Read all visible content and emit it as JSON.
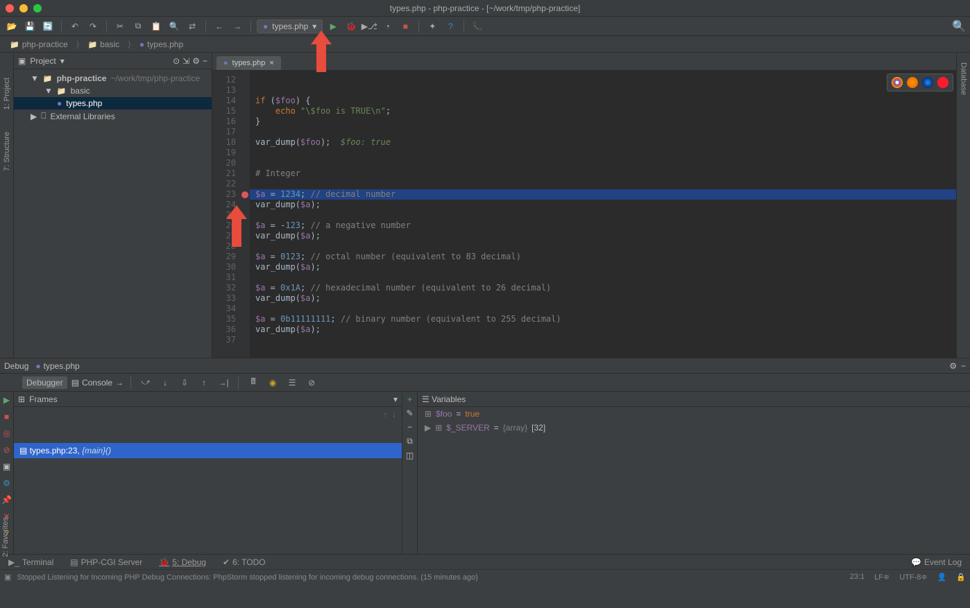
{
  "title": "types.php - php-practice - [~/work/tmp/php-practice]",
  "runConfig": {
    "label": "types.php"
  },
  "breadcrumb": {
    "root": "php-practice",
    "folder": "basic",
    "file": "types.php"
  },
  "projectPanel": {
    "title": "Project"
  },
  "tree": {
    "root": "php-practice",
    "rootPath": "~/work/tmp/php-practice",
    "folder": "basic",
    "file": "types.php",
    "external": "External Libraries"
  },
  "editorTab": {
    "label": "types.php"
  },
  "code": {
    "startLine": 12,
    "lines": [
      {
        "n": 12,
        "html": ""
      },
      {
        "n": 13,
        "html": ""
      },
      {
        "n": 14,
        "html": "<span class='kw'>if</span> (<span class='var'>$foo</span>) {"
      },
      {
        "n": 15,
        "html": "    <span class='kw'>echo</span> <span class='str'>\"\\$foo is TRUE\\n\"</span>;"
      },
      {
        "n": 16,
        "html": "}"
      },
      {
        "n": 17,
        "html": ""
      },
      {
        "n": 18,
        "html": "var_dump(<span class='var'>$foo</span>);  <span class='inl'>$foo: true</span>"
      },
      {
        "n": 19,
        "html": ""
      },
      {
        "n": 20,
        "html": ""
      },
      {
        "n": 21,
        "html": "<span class='com'># Integer</span>"
      },
      {
        "n": 22,
        "html": ""
      },
      {
        "n": 23,
        "html": "<span class='var'>$a</span> = <span class='num'>1234</span>; <span class='com'>// decimal number</span>",
        "hl": true,
        "bp": true
      },
      {
        "n": 24,
        "html": "var_dump(<span class='var'>$a</span>);"
      },
      {
        "n": 25,
        "html": ""
      },
      {
        "n": 26,
        "html": "<span class='var'>$a</span> = -<span class='num'>123</span>; <span class='com'>// a negative number</span>"
      },
      {
        "n": 27,
        "html": "var_dump(<span class='var'>$a</span>);"
      },
      {
        "n": 28,
        "html": ""
      },
      {
        "n": 29,
        "html": "<span class='var'>$a</span> = <span class='num'>0123</span>; <span class='com'>// octal number (equivalent to 83 decimal)</span>"
      },
      {
        "n": 30,
        "html": "var_dump(<span class='var'>$a</span>);"
      },
      {
        "n": 31,
        "html": ""
      },
      {
        "n": 32,
        "html": "<span class='var'>$a</span> = <span class='num'>0x1A</span>; <span class='com'>// hexadecimal number (equivalent to 26 decimal)</span>"
      },
      {
        "n": 33,
        "html": "var_dump(<span class='var'>$a</span>);"
      },
      {
        "n": 34,
        "html": ""
      },
      {
        "n": 35,
        "html": "<span class='var'>$a</span> = <span class='num'>0b11111111</span>; <span class='com'>// binary number (equivalent to 255 decimal)</span>"
      },
      {
        "n": 36,
        "html": "var_dump(<span class='var'>$a</span>);"
      },
      {
        "n": 37,
        "html": ""
      }
    ]
  },
  "leftTabs": {
    "project": "1: Project",
    "structure": "7: Structure",
    "favorites": "2: Favorites"
  },
  "rightTabs": {
    "database": "Database"
  },
  "debug": {
    "tabLabel": "Debug",
    "fileTab": "types.php",
    "subTabs": {
      "debugger": "Debugger",
      "console": "Console"
    },
    "framesTitle": "Frames",
    "frameItem": {
      "file": "types.php:23,",
      "fn": "{main}()"
    },
    "variablesTitle": "Variables",
    "vars": [
      {
        "name": "$foo",
        "eq": " = ",
        "val": "true"
      },
      {
        "name": "$_SERVER",
        "eq": " = ",
        "type": "{array}",
        "extra": " [32]"
      }
    ]
  },
  "bottomTabs": {
    "terminal": "Terminal",
    "phpcgi": "PHP-CGI Server",
    "debug": "5: Debug",
    "todo": "6: TODO",
    "eventlog": "Event Log"
  },
  "status": {
    "msg": "Stopped Listening for Incoming PHP Debug Connections: PhpStorm stopped listening for incoming debug connections. (15 minutes ago)",
    "pos": "23:1",
    "lineend": "LF≑",
    "encoding": "UTF-8≑"
  }
}
